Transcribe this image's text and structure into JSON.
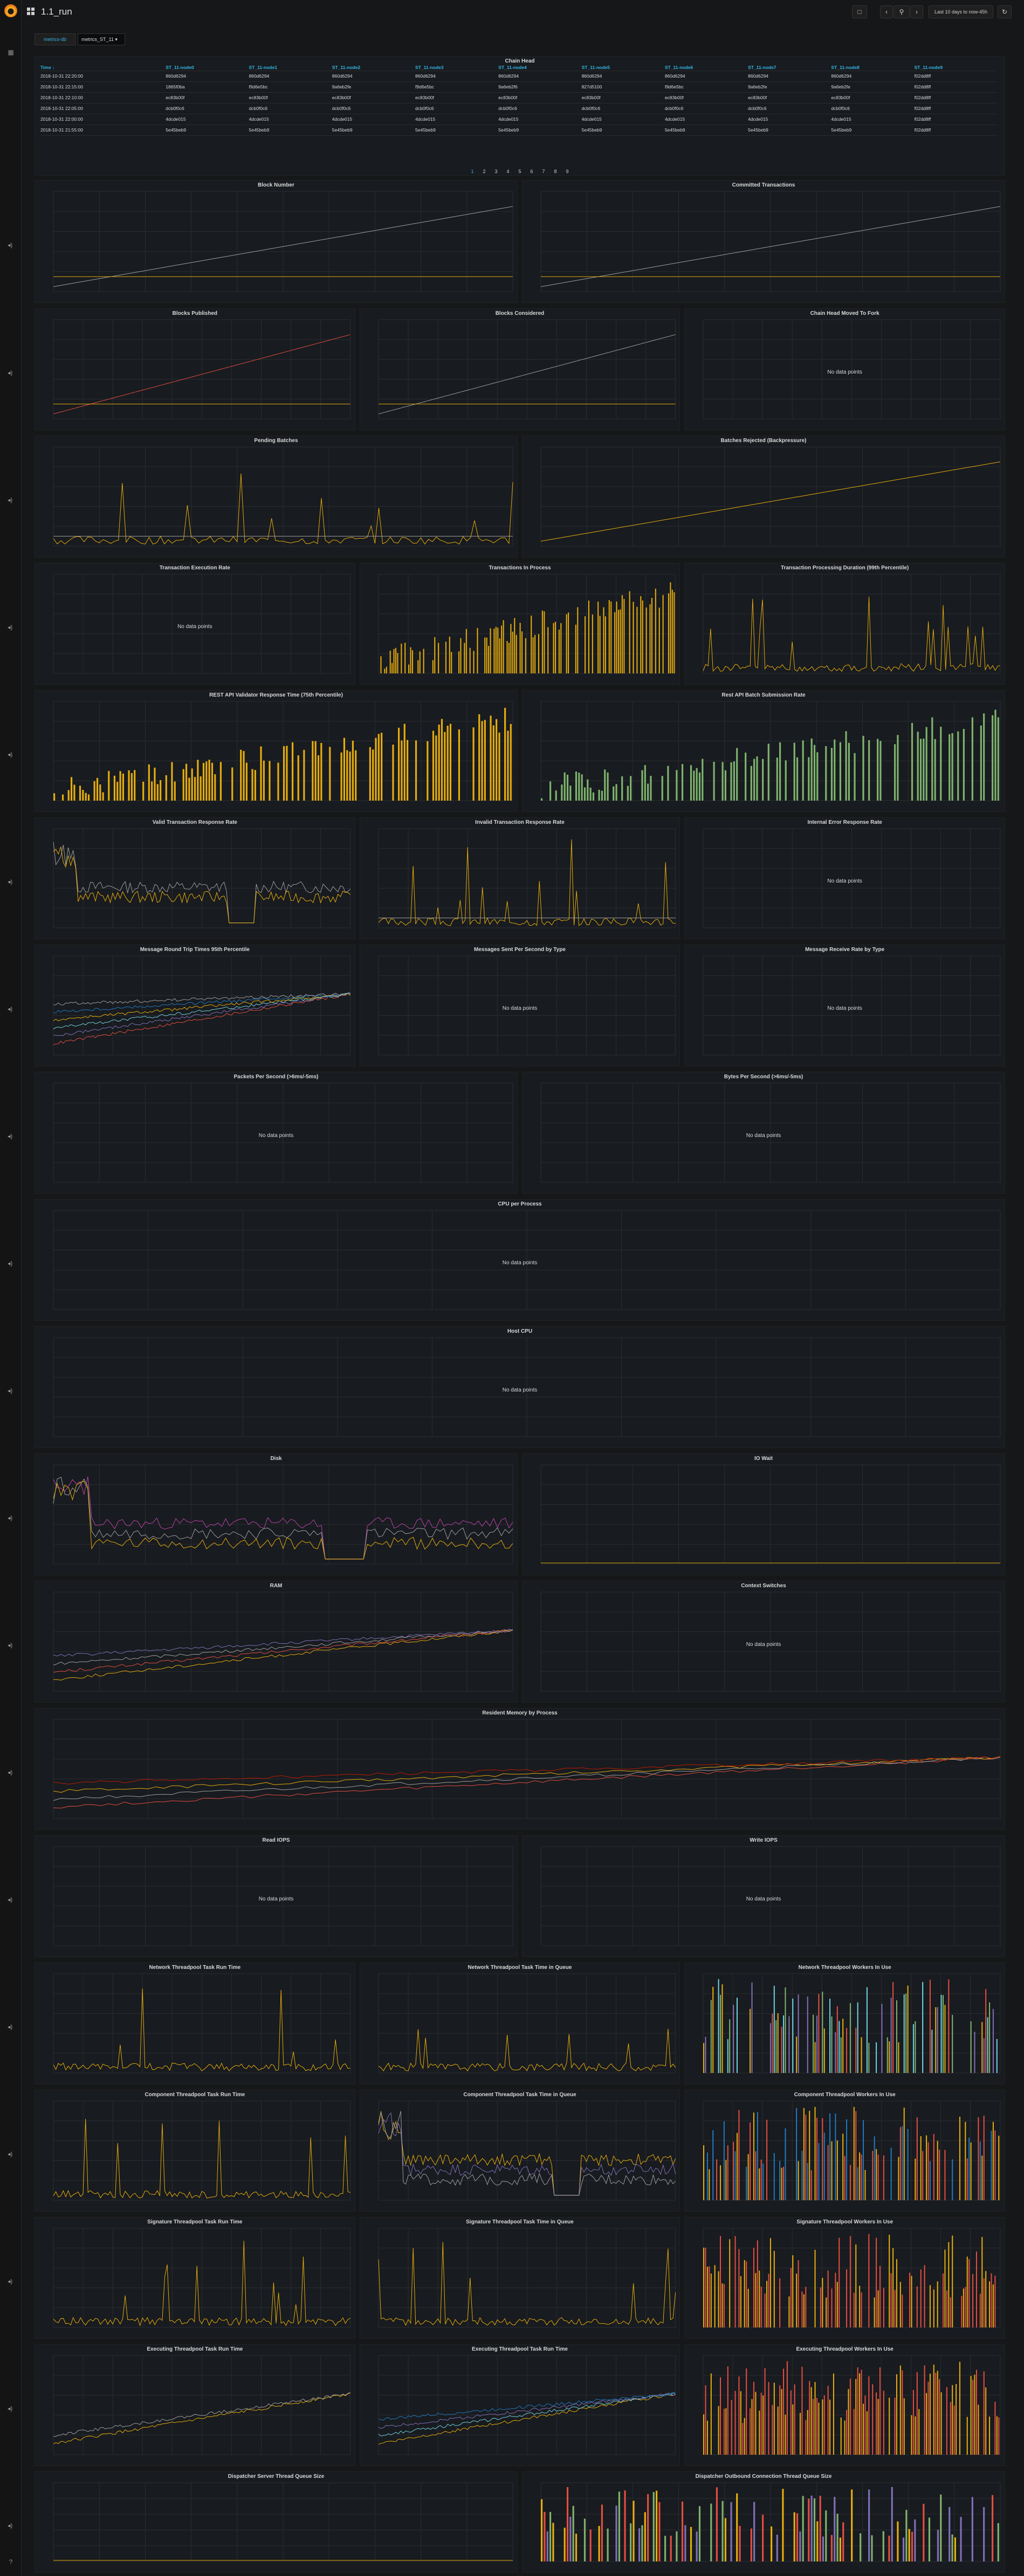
{
  "header": {
    "title": "1.1_run",
    "time_range": "Last 10 days to now-45h"
  },
  "variables": {
    "label": "metrics-db",
    "value": "metrics_ST_11 ▾"
  },
  "table": {
    "title": "Chain Head",
    "columns": [
      "Time ↓",
      "ST_11-node0",
      "ST_11-node1",
      "ST_11-node2",
      "ST_11-node3",
      "ST_11-node4",
      "ST_11-node5",
      "ST_11-node6",
      "ST_11-node7",
      "ST_11-node8",
      "ST_11-node9"
    ],
    "rows": [
      [
        "2018-10-31 22:20:00",
        "860d6294",
        "860d6294",
        "860d6294",
        "860d6294",
        "860d6294",
        "860d6294",
        "860d6294",
        "860d6294",
        "860d6294",
        "f02dd8ff"
      ],
      [
        "2018-10-31 22:15:00",
        "1865f0ba",
        "f9d6e5bc",
        "9a6eb2fe",
        "f9d6e5bc",
        "9a6eb2f6",
        "827d5100",
        "f9d6e5bc",
        "9a6eb2fe",
        "9a6eb2fe",
        "f02dd8ff"
      ],
      [
        "2018-10-31 22:10:00",
        "ec83b00f",
        "ec83b00f",
        "ec83b00f",
        "ec83b00f",
        "ec83b00f",
        "ec83b00f",
        "ec83b00f",
        "ec83b00f",
        "ec83b00f",
        "f02dd8ff"
      ],
      [
        "2018-10-31 22:05:00",
        "dcb0f0c6",
        "dcb0f0c6",
        "dcb0f0c6",
        "dcb0f0c6",
        "dcb0f0c6",
        "dcb0f0c6",
        "dcb0f0c6",
        "dcb0f0c6",
        "dcb0f0c6",
        "f02dd8ff"
      ],
      [
        "2018-10-31 22:00:00",
        "4dcde015",
        "4dcde015",
        "4dcde015",
        "4dcde015",
        "4dcde015",
        "4dcde015",
        "4dcde015",
        "4dcde015",
        "4dcde015",
        "f02dd8ff"
      ],
      [
        "2018-10-31 21:55:00",
        "5e45beb9",
        "5e45beb9",
        "5e45beb9",
        "5e45beb9",
        "5e45beb9",
        "5e45beb9",
        "5e45beb9",
        "5e45beb9",
        "5e45beb9",
        "f02dd8ff"
      ]
    ],
    "pages": [
      "1",
      "2",
      "3",
      "4",
      "5",
      "6",
      "7",
      "8",
      "9"
    ]
  },
  "no_data": "No data points",
  "panels": [
    {
      "title": "Block Number",
      "type": "line",
      "colors": [
        "#9e9e9e",
        "#e5ac0e"
      ]
    },
    {
      "title": "Committed Transactions",
      "type": "line",
      "colors": [
        "#9e9e9e",
        "#e5ac0e"
      ]
    },
    {
      "title": "Blocks Published",
      "type": "line",
      "colors": [
        "#e24d42",
        "#e5ac0e"
      ]
    },
    {
      "title": "Blocks Considered",
      "type": "line",
      "colors": [
        "#9e9e9e",
        "#e5ac0e"
      ]
    },
    {
      "title": "Chain Head Moved To Fork",
      "type": "nodata"
    },
    {
      "title": "Pending Batches",
      "type": "spiky",
      "colors": [
        "#e5ac0e",
        "#9e9e9e"
      ]
    },
    {
      "title": "Batches Rejected (Backpressure)",
      "type": "line",
      "colors": [
        "#e5ac0e"
      ]
    },
    {
      "title": "Transaction Execution Rate",
      "type": "nodata"
    },
    {
      "title": "Transactions In Process",
      "type": "bars",
      "colors": [
        "#e5ac0e"
      ]
    },
    {
      "title": "Transaction Processing Duration (99th Percentile)",
      "type": "spiky",
      "colors": [
        "#e5ac0e"
      ]
    },
    {
      "title": "REST API Validator Response Time (75th Percentile)",
      "type": "bars",
      "colors": [
        "#e5ac0e"
      ]
    },
    {
      "title": "Rest API Batch Submission Rate",
      "type": "bars",
      "colors": [
        "#7eb26d"
      ]
    },
    {
      "title": "Valid Transaction Response Rate",
      "type": "noise",
      "colors": [
        "#9e9e9e",
        "#e5ac0e"
      ]
    },
    {
      "title": "Invalid Transaction Response Rate",
      "type": "spiky",
      "colors": [
        "#e5ac0e",
        "#9e9e9e"
      ]
    },
    {
      "title": "Internal Error Response Rate",
      "type": "nodata"
    },
    {
      "title": "Message Round Trip Times 95th Percentile",
      "type": "multi",
      "colors": [
        "#e24d42",
        "#806eb7",
        "#6ed0e0",
        "#e5ac0e",
        "#1f78c1",
        "#9e9e9e"
      ]
    },
    {
      "title": "Messages Sent Per Second by Type",
      "type": "nodata"
    },
    {
      "title": "Message Receive Rate by Type",
      "type": "nodata"
    },
    {
      "title": "Packets Per Second (>6ms/-5ms)",
      "type": "nodata"
    },
    {
      "title": "Bytes Per Second (>6ms/-5ms)",
      "type": "nodata"
    },
    {
      "title": "CPU per Process",
      "type": "nodata"
    },
    {
      "title": "Host CPU",
      "type": "nodata"
    },
    {
      "title": "Disk",
      "type": "noise",
      "colors": [
        "#ba43a9",
        "#9e9e9e",
        "#e5ac0e"
      ]
    },
    {
      "title": "IO Wait",
      "type": "flat",
      "colors": [
        "#e5ac0e"
      ]
    },
    {
      "title": "RAM",
      "type": "multi",
      "colors": [
        "#e5ac0e",
        "#e24d42",
        "#9e9e9e",
        "#806eb7"
      ]
    },
    {
      "title": "Context Switches",
      "type": "nodata"
    },
    {
      "title": "Resident Memory by Process",
      "type": "multi",
      "colors": [
        "#e24d42",
        "#9e9e9e",
        "#e5ac0e",
        "#bf1b00"
      ]
    },
    {
      "title": "Read IOPS",
      "type": "nodata"
    },
    {
      "title": "Write IOPS",
      "type": "nodata"
    },
    {
      "title": "Network Threadpool Task Run Time",
      "type": "spiky",
      "colors": [
        "#e5ac0e"
      ]
    },
    {
      "title": "Network Threadpool Task Time in Queue",
      "type": "spiky",
      "colors": [
        "#e5ac0e"
      ]
    },
    {
      "title": "Network Threadpool Workers In Use",
      "type": "colorbars",
      "colors": [
        "#e5ac0e",
        "#806eb7",
        "#e24d42",
        "#6ed0e0",
        "#7eb26d"
      ]
    },
    {
      "title": "Component Threadpool Task Run Time",
      "type": "spiky",
      "colors": [
        "#e5ac0e"
      ]
    },
    {
      "title": "Component Threadpool Task Time in Queue",
      "type": "noise",
      "colors": [
        "#e5ac0e",
        "#806eb7",
        "#9e9e9e"
      ]
    },
    {
      "title": "Component Threadpool Workers In Use",
      "type": "colorbars",
      "colors": [
        "#e5ac0e",
        "#e24d42",
        "#1f78c1"
      ]
    },
    {
      "title": "Signature Threadpool Task Run Time",
      "type": "spiky",
      "colors": [
        "#e5ac0e"
      ]
    },
    {
      "title": "Signature Threadpool Task Time in Queue",
      "type": "spiky",
      "colors": [
        "#e5ac0e"
      ]
    },
    {
      "title": "Signature Threadpool Workers In Use",
      "type": "colorbars",
      "colors": [
        "#e5ac0e",
        "#e24d42"
      ]
    },
    {
      "title": "Executing Threadpool Task Run Time",
      "type": "multi",
      "colors": [
        "#e5ac0e",
        "#9e9e9e"
      ]
    },
    {
      "title": "Executing Threadpool Task Run Time",
      "type": "multi",
      "colors": [
        "#e5ac0e",
        "#6ed0e0",
        "#806eb7",
        "#1f78c1"
      ]
    },
    {
      "title": "Executing Threadpool Workers In Use",
      "type": "colorbars",
      "colors": [
        "#e5ac0e",
        "#e24d42"
      ]
    },
    {
      "title": "Dispatcher Server Thread Queue Size",
      "type": "flat",
      "colors": [
        "#e5ac0e"
      ]
    },
    {
      "title": "Dispatcher Outbound Connection Thread Queue Size",
      "type": "colorbars",
      "colors": [
        "#e5ac0e",
        "#e24d42",
        "#806eb7",
        "#7eb26d"
      ]
    }
  ],
  "icons": {
    "sidebar_grid": "grid-icon",
    "sidebar_help": "help-icon",
    "share": "share-icon",
    "zoom": "zoom-out-icon",
    "refresh": "refresh-icon",
    "row_speaker": "speaker-icon"
  }
}
